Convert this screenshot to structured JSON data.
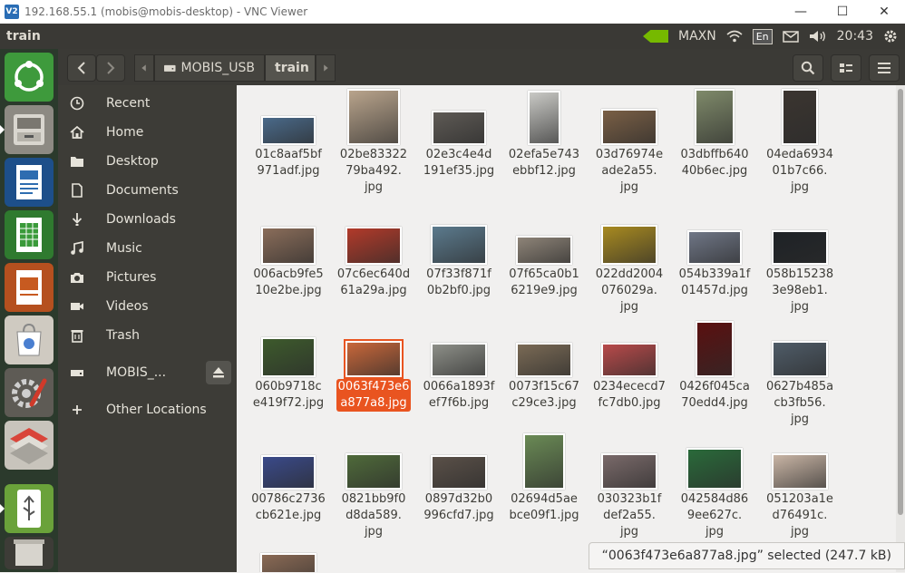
{
  "vnc": {
    "title": "192.168.55.1 (mobis@mobis-desktop) - VNC Viewer",
    "logo": "V2",
    "minimize": "—",
    "maximize": "☐",
    "close": "✕"
  },
  "topbar": {
    "app": "train",
    "tray_gpu_label": "MAXN",
    "lang": "En",
    "time": "20:43"
  },
  "path": {
    "usb_label": "MOBIS_USB",
    "current": "train"
  },
  "sidebar": {
    "items": [
      {
        "label": "Recent",
        "icon": "clock-icon"
      },
      {
        "label": "Home",
        "icon": "home-icon"
      },
      {
        "label": "Desktop",
        "icon": "folder-icon"
      },
      {
        "label": "Documents",
        "icon": "document-icon"
      },
      {
        "label": "Downloads",
        "icon": "download-icon"
      },
      {
        "label": "Music",
        "icon": "music-icon"
      },
      {
        "label": "Pictures",
        "icon": "camera-icon"
      },
      {
        "label": "Videos",
        "icon": "video-icon"
      },
      {
        "label": "Trash",
        "icon": "trash-icon"
      },
      {
        "label": "MOBIS_...",
        "icon": "drive-icon"
      },
      {
        "label": "Other Locations",
        "icon": "plus-icon"
      }
    ]
  },
  "files": [
    {
      "name": "01c8aaf5bf\n971adf.jpg",
      "color": "#4a6a8a"
    },
    {
      "name": "02be83322\n79ba492.\njpg",
      "color": "#b9a48c"
    },
    {
      "name": "02e3c4e4d\n191ef35.jpg",
      "color": "#5e5a55"
    },
    {
      "name": "02efa5e743\nebbf12.jpg",
      "color": "#c9c9c5"
    },
    {
      "name": "03d76974e\nade2a55.\njpg",
      "color": "#7a5f45"
    },
    {
      "name": "03dbffb640\n40b6ec.jpg",
      "color": "#7f8a6a"
    },
    {
      "name": "04eda6934\n01b7c66.\njpg",
      "color": "#3b3530"
    },
    {
      "name": "006acb9fe5\n10e2be.jpg",
      "color": "#8a6d5a"
    },
    {
      "name": "07c6ec640d\n61a29a.jpg",
      "color": "#b23a2a"
    },
    {
      "name": "07f33f871f\n0b2bf0.jpg",
      "color": "#5b7a8d"
    },
    {
      "name": "07f65ca0b1\n6219e9.jpg",
      "color": "#8e8478"
    },
    {
      "name": "022dd2004\n076029a.\njpg",
      "color": "#a88a20"
    },
    {
      "name": "054b339a1f\n01457d.jpg",
      "color": "#6f7686"
    },
    {
      "name": "058b15238\n3e98eb1.\njpg",
      "color": "#1e2226"
    },
    {
      "name": "060b9718c\ne419f72.jpg",
      "color": "#3d5a2c"
    },
    {
      "name": "0063f473e6\na877a8.jpg",
      "color": "#c8673a",
      "selected": true
    },
    {
      "name": "0066a1893f\nef7f6b.jpg",
      "color": "#8d8f88"
    },
    {
      "name": "0073f15c67\nc29ce3.jpg",
      "color": "#7a6a55"
    },
    {
      "name": "0234ececd7\nfc7db0.jpg",
      "color": "#b84a4a"
    },
    {
      "name": "0426f045ca\n70edd4.jpg",
      "color": "#5a1010"
    },
    {
      "name": "0627b485a\ncb3fb56.\njpg",
      "color": "#4f5c68"
    },
    {
      "name": "00786c2736\ncb621e.jpg",
      "color": "#3a4a8a"
    },
    {
      "name": "0821bb9f0\nd8da589.\njpg",
      "color": "#4f6a3a"
    },
    {
      "name": "0897d32b0\n996cfd7.jpg",
      "color": "#5a5048"
    },
    {
      "name": "02694d5ae\nbce09f1.jpg",
      "color": "#6a8a55"
    },
    {
      "name": "030323b1f\ndef2a55.\njpg",
      "color": "#7a6a6a"
    },
    {
      "name": "042584d86\n9ee627c.\njpg",
      "color": "#2a6a3a"
    },
    {
      "name": "051203a1e\nd76491c.\njpg",
      "color": "#c9b5a5"
    },
    {
      "name": "",
      "color": "#8a6a55"
    }
  ],
  "status": "“0063f473e6a877a8.jpg” selected  (247.7 kB)"
}
